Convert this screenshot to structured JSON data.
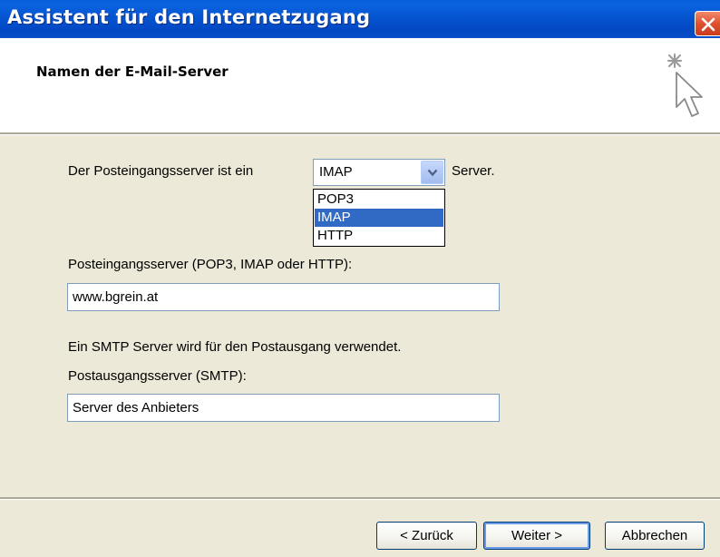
{
  "window": {
    "title": "Assistent für den Internetzugang"
  },
  "header": {
    "title": "Namen der E-Mail-Server",
    "icon": "wizard-wand-cursor-icon"
  },
  "incoming_type": {
    "label_prefix": "Der Posteingangsserver ist ein",
    "selected": "IMAP",
    "label_suffix": "Server.",
    "options": [
      "POP3",
      "IMAP",
      "HTTP"
    ],
    "highlighted_option": "IMAP"
  },
  "incoming_server": {
    "label": "Posteingangsserver (POP3, IMAP oder HTTP):",
    "value": "www.bgrein.at"
  },
  "smtp_info": "Ein SMTP Server wird für den Postausgang verwendet.",
  "outgoing_server": {
    "label": "Postausgangsserver (SMTP):",
    "value": "Server des Anbieters"
  },
  "buttons": {
    "back": "< Zurück",
    "next": "Weiter >",
    "cancel": "Abbrechen"
  },
  "colors": {
    "titlebar": "#0554d0",
    "dialog_bg": "#ece9d8",
    "selection": "#316ac5",
    "close_button": "#e0512e"
  }
}
